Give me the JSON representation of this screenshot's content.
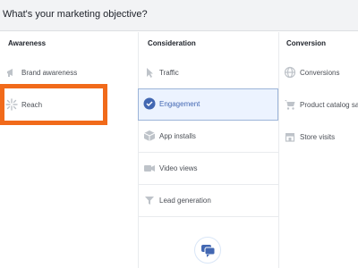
{
  "header": {
    "title": "What's your marketing objective?"
  },
  "columns": {
    "awareness": {
      "title": "Awareness",
      "items": [
        {
          "label": "Brand awareness",
          "icon": "megaphone-icon"
        },
        {
          "label": "Reach",
          "icon": "sparkle-icon"
        }
      ]
    },
    "consideration": {
      "title": "Consideration",
      "items": [
        {
          "label": "Traffic",
          "icon": "cursor-icon"
        },
        {
          "label": "Engagement",
          "icon": "check-circle-icon",
          "selected": true
        },
        {
          "label": "App installs",
          "icon": "cube-icon"
        },
        {
          "label": "Video views",
          "icon": "video-camera-icon"
        },
        {
          "label": "Lead generation",
          "icon": "filter-icon"
        }
      ]
    },
    "conversion": {
      "title": "Conversion",
      "items": [
        {
          "label": "Conversions",
          "icon": "globe-icon"
        },
        {
          "label": "Product catalog sales",
          "icon": "cart-icon"
        },
        {
          "label": "Store visits",
          "icon": "store-icon"
        }
      ]
    }
  },
  "colors": {
    "accent": "#4267b2",
    "highlight_box": "#f16a1a",
    "selected_bg": "#ecf3ff"
  },
  "chat_button": {
    "icon": "chat-bubble-icon"
  }
}
